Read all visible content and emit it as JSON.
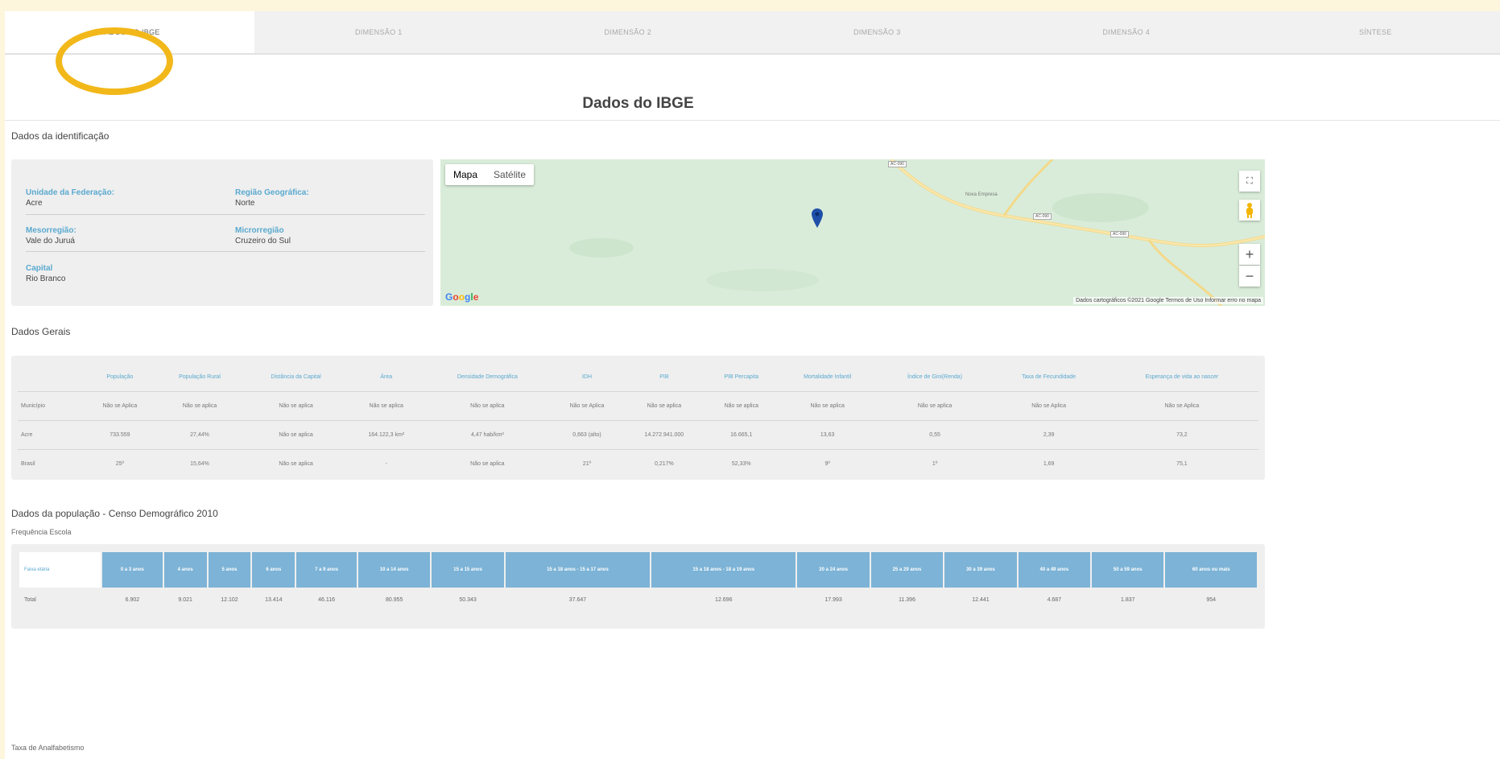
{
  "tabs": [
    {
      "label": "DADOS DO IBGE",
      "active": true
    },
    {
      "label": "DIMENSÃO 1",
      "active": false
    },
    {
      "label": "DIMENSÃO 2",
      "active": false
    },
    {
      "label": "DIMENSÃO 3",
      "active": false
    },
    {
      "label": "DIMENSÃO 4",
      "active": false
    },
    {
      "label": "SÍNTESE",
      "active": false
    }
  ],
  "page_title": "Dados do IBGE",
  "identificacao": {
    "heading": "Dados da identificação",
    "uf_label": "Unidade da Federação:",
    "uf_value": "Acre",
    "regiao_label": "Região Geográfica:",
    "regiao_value": "Norte",
    "meso_label": "Mesorregião:",
    "meso_value": "Vale do Juruá",
    "micro_label": "Microrregião",
    "micro_value": "Cruzeiro do Sul",
    "capital_label": "Capital",
    "capital_value": "Rio Branco"
  },
  "map": {
    "mapa_label": "Mapa",
    "satelite_label": "Satélite",
    "google_label": "Google",
    "credits": "Dados cartográficos ©2021 Google   Termos de Uso   Informar erro no mapa",
    "place_label": "Nova Empresa",
    "road_labels": [
      "AC-090",
      "AC-090",
      "AC-090"
    ],
    "zoom_in": "+",
    "zoom_out": "−",
    "fullscreen_icon": "fullscreen-icon",
    "pegman_icon": "pegman-icon",
    "marker_icon": "map-marker-icon"
  },
  "gerais": {
    "heading": "Dados Gerais",
    "columns": [
      "População",
      "População Rural",
      "Distância da Capital",
      "Área",
      "Densidade Demográfica",
      "IDH",
      "PIB",
      "PIB Percapita",
      "Mortalidade Infantil",
      "Índice de Gini(Renda)",
      "Taxa de Fecundidade",
      "Esperança de vida ao nascer"
    ],
    "rows": [
      {
        "label": "Município",
        "cells": [
          "Não se Aplica",
          "Não se aplica",
          "Não se aplica",
          "Não se aplica",
          "Não se aplica",
          "Não se Aplica",
          "Não se aplica",
          "Não se aplica",
          "Não se aplica",
          "Não se aplica",
          "Não se Aplica",
          "Não se Aplica"
        ]
      },
      {
        "label": "Acre",
        "cells": [
          "733.559",
          "27,44%",
          "Não se aplica",
          "164.122,3 km²",
          "4,47 hab/km²",
          "0,663 (alto)",
          "14.272.941.000",
          "16.665,1",
          "13,63",
          "0,55",
          "2,39",
          "73,2"
        ]
      },
      {
        "label": "Brasil",
        "cells": [
          "25º",
          "15,64%",
          "Não se aplica",
          "-",
          "Não se aplica",
          "21º",
          "0,217%",
          "52,33%",
          "9º",
          "1º",
          "1,69",
          "75,1"
        ]
      }
    ]
  },
  "populacao": {
    "heading": "Dados da população - Censo Demográfico 2010",
    "freq_heading": "Frequência Escola",
    "row_header": "Faixa etária",
    "columns": [
      "0 a 3 anos",
      "4 anos",
      "5 anos",
      "6 anos",
      "7 a 9 anos",
      "10 a 14 anos",
      "15 a 15 anos",
      "15 a 18 anos - 15 a 17 anos",
      "15 a 18 anos - 18 a 19 anos",
      "20 a 24 anos",
      "25 a 29 anos",
      "30 a 39 anos",
      "40 a 49 anos",
      "50 a 59 anos",
      "60 anos ou mais"
    ],
    "total_label": "Total",
    "totals": [
      "6.902",
      "9.021",
      "12.102",
      "13.414",
      "46.116",
      "80.955",
      "50.343",
      "37.647",
      "12.696",
      "17.993",
      "11.396",
      "12.441",
      "4.687",
      "1.837",
      "954"
    ],
    "analfabetismo_heading": "Taxa de Analfabetismo"
  },
  "colors": {
    "accent": "#5aa9cf",
    "header_blue": "#7cb3d6",
    "highlight": "#f2b81a",
    "background": "#fdf6dc"
  }
}
